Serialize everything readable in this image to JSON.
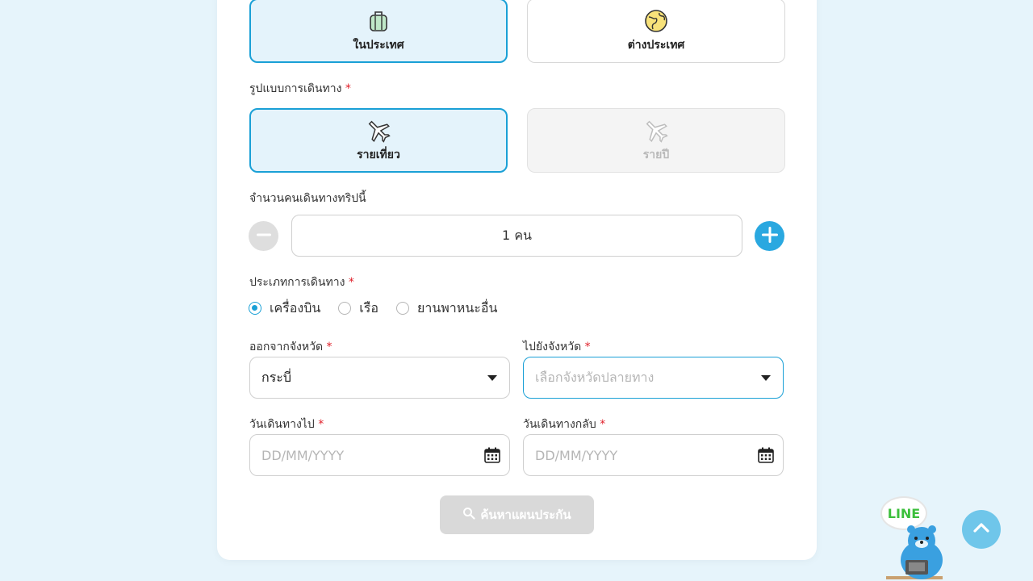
{
  "trip_scope": {
    "options": [
      {
        "label": "ในประเทศ",
        "icon": "luggage-icon",
        "selected": true
      },
      {
        "label": "ต่างประเทศ",
        "icon": "globe-icon",
        "selected": false
      }
    ]
  },
  "travel_format": {
    "label": "รูปแบบการเดินทาง",
    "required_mark": "*",
    "options": [
      {
        "label": "รายเที่ยว",
        "icon": "airplane-icon",
        "selected": true
      },
      {
        "label": "รายปี",
        "icon": "airplane-icon",
        "disabled": true
      }
    ]
  },
  "travelers": {
    "label": "จำนวนคนเดินทางทริปนี้",
    "value": "1 คน"
  },
  "travel_type": {
    "label": "ประเภทการเดินทาง",
    "required_mark": "*",
    "options": [
      {
        "label": "เครื่องบิน",
        "selected": true
      },
      {
        "label": "เรือ",
        "selected": false
      },
      {
        "label": "ยานพาหนะอื่น",
        "selected": false
      }
    ]
  },
  "from_province": {
    "label": "ออกจากจังหวัด",
    "required_mark": "*",
    "value": "กระบี่"
  },
  "to_province": {
    "label": "ไปยังจังหวัด",
    "required_mark": "*",
    "placeholder": "เลือกจังหวัดปลายทาง"
  },
  "depart_date": {
    "label": "วันเดินทางไป",
    "required_mark": "*",
    "placeholder": "DD/MM/YYYY"
  },
  "return_date": {
    "label": "วันเดินทางกลับ",
    "required_mark": "*",
    "placeholder": "DD/MM/YYYY"
  },
  "search_button": {
    "label": "ค้นหาแผนประกัน"
  },
  "line_chat": {
    "label": "LINE"
  },
  "colors": {
    "accent": "#1aa0d6",
    "plus_button": "#2aa8e0",
    "background": "#e6f4fb"
  }
}
